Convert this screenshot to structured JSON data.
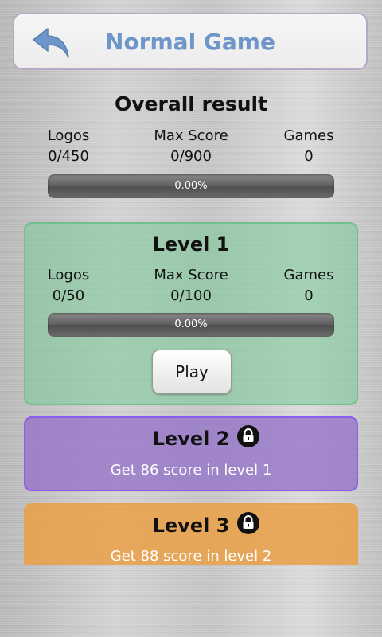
{
  "header": {
    "title": "Normal Game",
    "back_icon": "back-arrow-icon"
  },
  "overall": {
    "title": "Overall result",
    "logos_label": "Logos",
    "logos_value": "0/450",
    "maxscore_label": "Max Score",
    "maxscore_value": "0/900",
    "games_label": "Games",
    "games_value": "0",
    "progress_text": "0.00%",
    "progress_fraction": 0
  },
  "levels": [
    {
      "title": "Level 1",
      "locked": false,
      "logos_label": "Logos",
      "logos_value": "0/50",
      "maxscore_label": "Max Score",
      "maxscore_value": "0/100",
      "games_label": "Games",
      "games_value": "0",
      "progress_text": "0.00%",
      "progress_fraction": 0,
      "play_label": "Play",
      "color": "#78c896"
    },
    {
      "title": "Level 2",
      "locked": true,
      "requirement": "Get 86 score in level 1",
      "lock_icon": "lock-icon",
      "color": "#8a5ee8"
    },
    {
      "title": "Level 3",
      "locked": true,
      "requirement": "Get 88 score in level 2",
      "lock_icon": "lock-icon",
      "color": "#e9a24b"
    }
  ]
}
